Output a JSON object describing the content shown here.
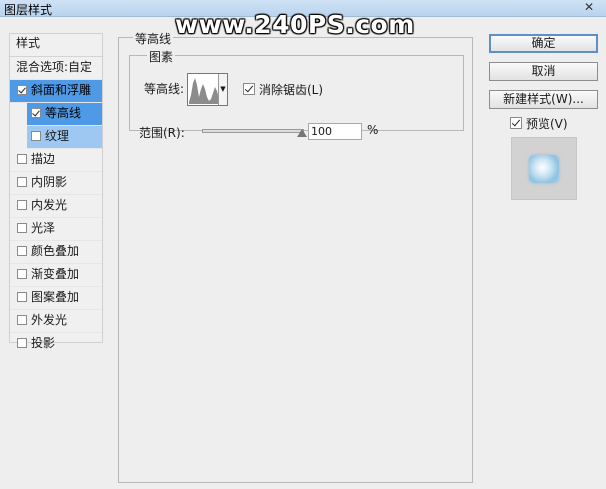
{
  "window": {
    "title": "图层样式",
    "close_glyph": "✕"
  },
  "watermark": "www.240PS.com",
  "left_panel": {
    "header": "样式",
    "blend_options": "混合选项:自定",
    "items": [
      {
        "label": "斜面和浮雕",
        "checked": true,
        "selected": true
      },
      {
        "label": "等高线",
        "checked": true,
        "selected": true,
        "sub": true
      },
      {
        "label": "纹理",
        "checked": false,
        "selected": true,
        "sub": true
      },
      {
        "label": "描边",
        "checked": false
      },
      {
        "label": "内阴影",
        "checked": false
      },
      {
        "label": "内发光",
        "checked": false
      },
      {
        "label": "光泽",
        "checked": false
      },
      {
        "label": "颜色叠加",
        "checked": false
      },
      {
        "label": "渐变叠加",
        "checked": false
      },
      {
        "label": "图案叠加",
        "checked": false
      },
      {
        "label": "外发光",
        "checked": false
      },
      {
        "label": "投影",
        "checked": false
      }
    ]
  },
  "contour_section": {
    "title": "等高线",
    "group_title": "图素",
    "contour_label": "等高线:",
    "antialias_label": "消除锯齿(L)",
    "antialias_checked": true,
    "range_label": "范围(R):",
    "range_value": "100",
    "range_unit": "%",
    "range_percent": 100
  },
  "buttons": {
    "ok": "确定",
    "cancel": "取消",
    "new_style": "新建样式(W)..."
  },
  "preview": {
    "label": "预览(V)",
    "checked": true
  },
  "colors": {
    "selected_strong": "#4f9ae6",
    "selected_soft": "#9ec8f2"
  }
}
